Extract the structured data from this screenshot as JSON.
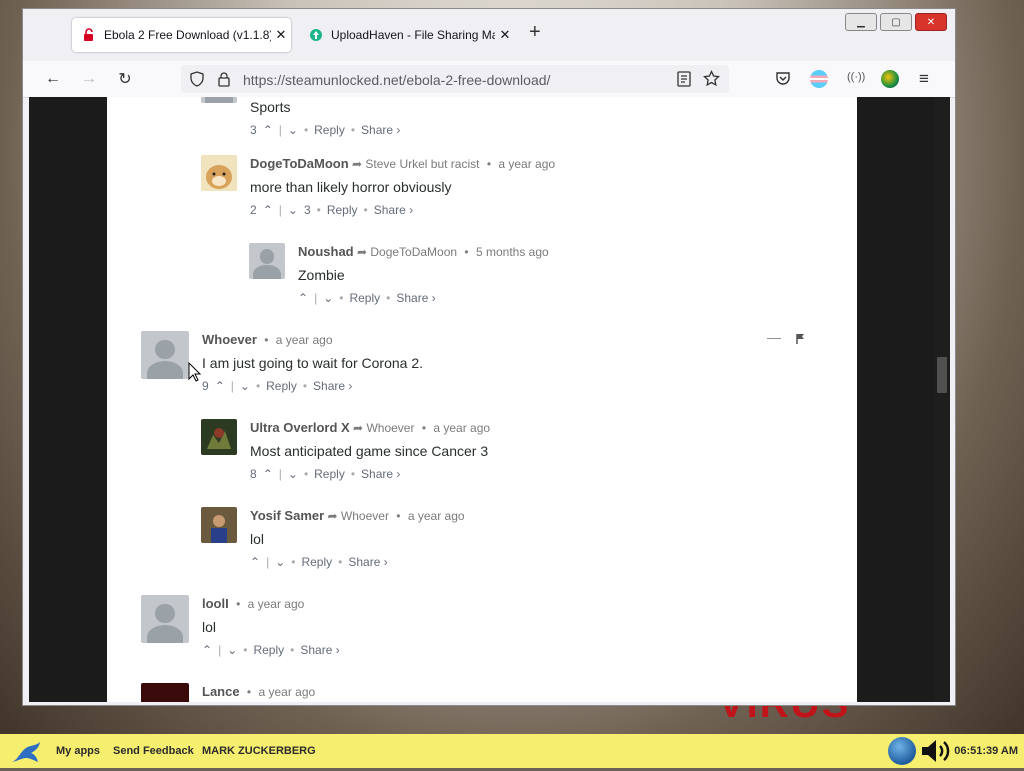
{
  "browser": {
    "tabs": [
      {
        "label": "Ebola 2 Free Download (v1.1.8)",
        "active": true
      },
      {
        "label": "UploadHaven - File Sharing Ma",
        "active": false
      }
    ],
    "url": "https://steamunlocked.net/ebola-2-free-download/"
  },
  "comments": [
    {
      "id": "c0",
      "text": "Sports",
      "upvotes": "3",
      "downvotes": "",
      "reply": "Reply",
      "share": "Share ›"
    },
    {
      "id": "c1",
      "author": "DogeToDaMoon",
      "reply_to": "Steve Urkel but racist",
      "time": "a year ago",
      "text": "more than likely horror obviously",
      "upvotes": "2",
      "downvotes": "3",
      "reply": "Reply",
      "share": "Share ›"
    },
    {
      "id": "c2",
      "author": "Noushad",
      "reply_to": "DogeToDaMoon",
      "time": "5 months ago",
      "text": "Zombie",
      "upvotes": "",
      "downvotes": "",
      "reply": "Reply",
      "share": "Share ›"
    },
    {
      "id": "c3",
      "author": "Whoever",
      "reply_to": "",
      "time": "a year ago",
      "text": "I am just going to wait for Corona 2.",
      "upvotes": "9",
      "downvotes": "",
      "reply": "Reply",
      "share": "Share ›"
    },
    {
      "id": "c4",
      "author": "Ultra Overlord X",
      "reply_to": "Whoever",
      "time": "a year ago",
      "text": "Most anticipated game since Cancer 3",
      "upvotes": "8",
      "downvotes": "",
      "reply": "Reply",
      "share": "Share ›"
    },
    {
      "id": "c5",
      "author": "Yosif Samer",
      "reply_to": "Whoever",
      "time": "a year ago",
      "text": "lol",
      "upvotes": "",
      "downvotes": "",
      "reply": "Reply",
      "share": "Share ›"
    },
    {
      "id": "c6",
      "author": "loolI",
      "reply_to": "",
      "time": "a year ago",
      "text": "lol",
      "upvotes": "",
      "downvotes": "",
      "reply": "Reply",
      "share": "Share ›"
    },
    {
      "id": "c7",
      "author": "Lance",
      "reply_to": "",
      "time": "a year ago"
    }
  ],
  "taskbar": {
    "items": [
      "My apps",
      "Send Feedback",
      "MARK ZUCKERBERG"
    ],
    "clock": "06:51:39 AM"
  },
  "icons": {
    "reply_arrow": "share-arrow-icon",
    "upvote": "chevron-up-icon",
    "downvote": "chevron-down-icon",
    "flag": "flag-icon",
    "collapse": "minus-icon"
  },
  "colors": {
    "accent_taskbar": "#f6ee6f",
    "page_bg": "#ffffff",
    "page_gutter": "#1b1b1b"
  }
}
